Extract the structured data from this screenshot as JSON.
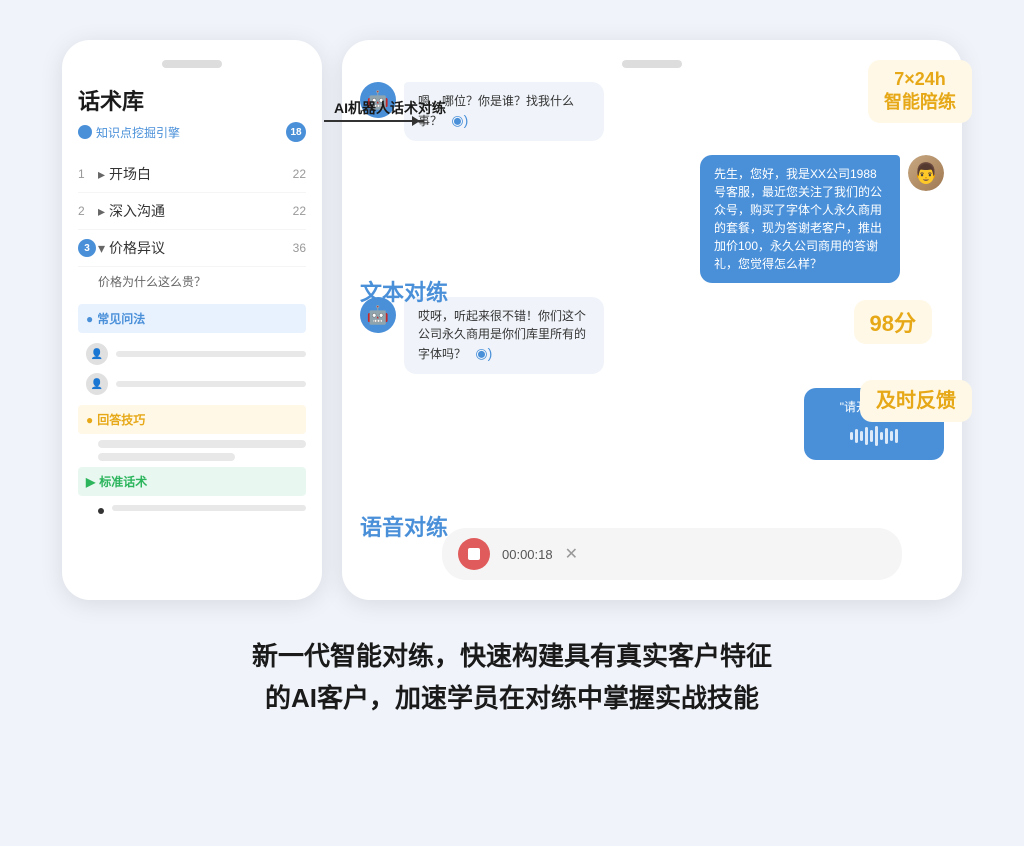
{
  "page": {
    "background": "#f0f4fa"
  },
  "left_panel": {
    "title": "话术库",
    "subtitle": "知识点挖掘引擎",
    "badge": "18",
    "menu_items": [
      {
        "num": "1",
        "label": "开场白",
        "count": "22",
        "active": false
      },
      {
        "num": "2",
        "label": "深入沟通",
        "count": "22",
        "active": false
      },
      {
        "num": "3",
        "label": "价格异议",
        "count": "36",
        "active": true
      }
    ],
    "sub_question": "价格为什么这么贵？",
    "sections": [
      {
        "type": "blue",
        "label": "常见问法"
      },
      {
        "type": "yellow",
        "label": "回答技巧"
      },
      {
        "type": "green",
        "label": "标准话术"
      }
    ]
  },
  "arrow": {
    "label": "AI机器人话术对练"
  },
  "right_panel": {
    "messages": [
      {
        "side": "left",
        "text": "嗯，哪位？你是谁？找我什么事？",
        "has_sound": true
      },
      {
        "side": "right",
        "text": "先生，您好，我是XX公司1988号客服，最近您关注了我们的公众号，购买了字体个人永久商用的套餐，现为答谢老客户，推出加价100，永久公司商用的答谢礼，您觉得怎么样？"
      },
      {
        "side": "left",
        "text": "哎呀，听起来很不错！你们这个公司永久商用是你们库里所有的字体吗？",
        "has_sound": true
      },
      {
        "side": "right_voice",
        "text": "\"请开始发言\""
      }
    ],
    "score": "98分",
    "text_practice": "文本对练",
    "voice_practice": "语音对练",
    "timer": "00:00:18",
    "badge_247": "7×24h\n智能陪练",
    "badge_timely": "及时反馈"
  },
  "bottom_text": {
    "line1": "新一代智能对练，快速构建具有真实客户特征",
    "line2": "的AI客户，加速学员在对练中掌握实战技能"
  }
}
